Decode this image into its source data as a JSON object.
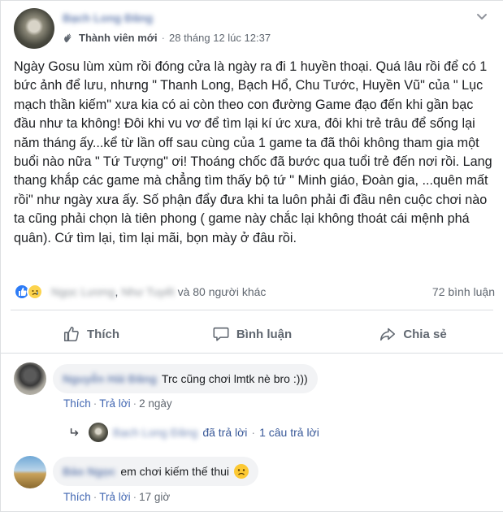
{
  "post": {
    "author": "Bạch Long Đăng",
    "badge": "Thành viên mới",
    "timestamp": "28 tháng 12 lúc 12:37",
    "text": "Ngày Gosu lùm xùm rồi đóng cửa là ngày ra đi 1 huyền thoại. Quá lâu rồi để có 1 bức ảnh để lưu, nhưng \" Thanh Long, Bạch Hổ, Chu Tước, Huyền Vũ\" của \" Lục mạch thần kiếm\" xưa kia có ai còn theo con đường Game đạo đến khi gần bạc đầu như ta không! Đôi khi vu vơ để tìm lại kí ức xưa, đôi khi trẻ trâu để sống lại năm tháng ấy...kể từ lần off sau cùng của 1 game ta đã thôi không tham gia một buổi nào nữa \" Tứ Tượng\" ơi! Thoáng chốc đã bước qua tuổi trẻ đến nơi rồi. Lang thang khắp các game mà chẳng tìm thấy bộ tứ \" Minh giáo, Đoàn gia, ...quên mất rồi\" như ngày xưa ấy. Số phận đẩy đưa khi ta luôn phải đi đầu nên cuộc chơi nào ta cũng phải chọn là tiên phong ( game này chắc lại không thoát cái mệnh phá quân). Cứ tìm lại, tìm lại mãi, bọn mày ở đâu rồi."
  },
  "reactions": {
    "names_blurred_1": "Ngọc Lương",
    "names_blurred_2": "Như Tuyết",
    "others": "và 80 người khác",
    "comment_count": "72 bình luận"
  },
  "actions": {
    "like": "Thích",
    "comment": "Bình luận",
    "share": "Chia sẻ"
  },
  "comments": [
    {
      "author": "Nguyễn Hải Đăng",
      "text": "Trc cũng chơi lmtk nè bro :)))",
      "like": "Thích",
      "reply": "Trả lời",
      "time": "2 ngày",
      "reply_summary": {
        "replier": "Bạch Long Đăng",
        "replied": "đã trả lời",
        "count": "1 câu trả lời"
      }
    },
    {
      "author": "Bảo Ngọc",
      "text": "em chơi kiếm thế thui",
      "like": "Thích",
      "reply": "Trả lời",
      "time": "17 giờ"
    }
  ],
  "icons": {
    "header_menu": "chevron-down-icon",
    "badge": "wave-hand-icon",
    "like": "thumbs-up-icon",
    "comment": "speech-bubble-icon",
    "share": "share-arrow-icon"
  }
}
